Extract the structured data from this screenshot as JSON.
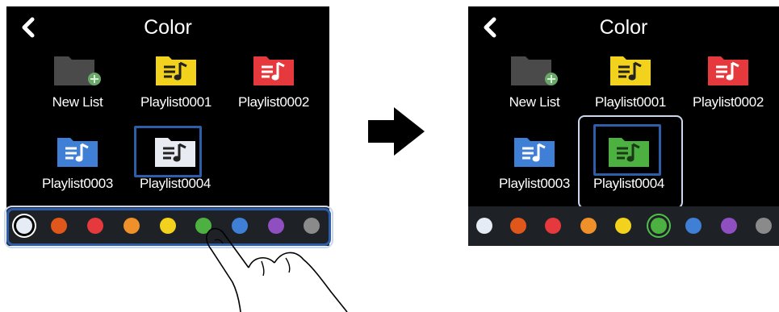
{
  "left_screen": {
    "title": "Color",
    "items": [
      {
        "label": "New List",
        "color": "#4a4a4a",
        "kind": "new"
      },
      {
        "label": "Playlist0001",
        "color": "#f2d21c",
        "kind": "playlist"
      },
      {
        "label": "Playlist0002",
        "color": "#e5393d",
        "kind": "playlist"
      },
      {
        "label": "Playlist0003",
        "color": "#3f7fd6",
        "kind": "playlist"
      },
      {
        "label": "Playlist0004",
        "color": "#e8ecf2",
        "kind": "playlist",
        "selected": true
      }
    ],
    "palette": [
      "#e6ecf5",
      "#e0571b",
      "#e5393d",
      "#f0902a",
      "#f2d21c",
      "#4db142",
      "#3f7fd6",
      "#8f4fc0",
      "#8a8a8a"
    ],
    "selected_color_index": 0
  },
  "right_screen": {
    "title": "Color",
    "items": [
      {
        "label": "New List",
        "color": "#4a4a4a",
        "kind": "new"
      },
      {
        "label": "Playlist0001",
        "color": "#f2d21c",
        "kind": "playlist"
      },
      {
        "label": "Playlist0002",
        "color": "#e5393d",
        "kind": "playlist"
      },
      {
        "label": "Playlist0003",
        "color": "#3f7fd6",
        "kind": "playlist"
      },
      {
        "label": "Playlist0004",
        "color": "#4db142",
        "kind": "playlist",
        "selected": true
      }
    ],
    "palette": [
      "#e6ecf5",
      "#e0571b",
      "#e5393d",
      "#f0902a",
      "#f2d21c",
      "#4db142",
      "#3f7fd6",
      "#8f4fc0",
      "#8a8a8a"
    ],
    "selected_color_index": 5
  },
  "icons": {
    "back": "chevron-left-icon",
    "new_list": "folder-plus-icon",
    "playlist": "playlist-folder-icon",
    "transition": "arrow-right-icon",
    "gesture": "tap-hand-icon"
  }
}
